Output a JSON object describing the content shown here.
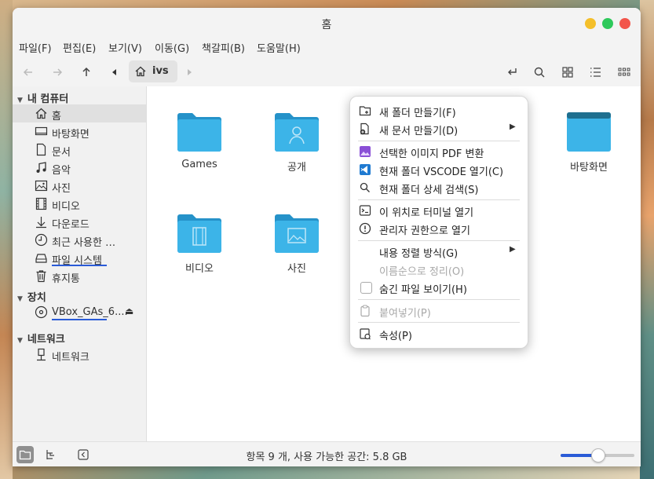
{
  "window": {
    "title": "홈"
  },
  "menubar": [
    "파일(F)",
    "편집(E)",
    "보기(V)",
    "이동(G)",
    "책갈피(B)",
    "도움말(H)"
  ],
  "toolbar": {
    "path_label": "ivs"
  },
  "sidebar": {
    "sections": [
      {
        "title": "내 컴퓨터",
        "items": [
          "홈",
          "바탕화면",
          "문서",
          "음악",
          "사진",
          "비디오",
          "다운로드",
          "최근 사용한 …",
          "파일 시스템",
          "휴지통"
        ]
      },
      {
        "title": "장치",
        "items": [
          "VBox_GAs_6...."
        ]
      },
      {
        "title": "네트워크",
        "items": [
          "네트워크"
        ]
      }
    ]
  },
  "files": [
    "Games",
    "공개",
    "바탕화면",
    "비디오",
    "사진"
  ],
  "context_menu": {
    "items": [
      "새 폴더 만들기(F)",
      "새 문서 만들기(D)",
      "선택한 이미지 PDF 변환",
      "현재 폴더 VSCODE 열기(C)",
      "현재 폴더 상세 검색(S)",
      "이 위치로 터미널 열기",
      "관리자 권한으로 열기",
      "내용 정렬 방식(G)",
      "이름순으로 정리(O)",
      "숨긴 파일 보이기(H)",
      "붙여넣기(P)",
      "속성(P)"
    ]
  },
  "status": {
    "text": "항목 9 개, 사용 가능한 공간: 5.8 GB",
    "zoom_fraction": 0.5
  },
  "colors": {
    "accent": "#2a5bd7",
    "folder": "#3cb4e8",
    "folder_dark": "#2592c9"
  }
}
